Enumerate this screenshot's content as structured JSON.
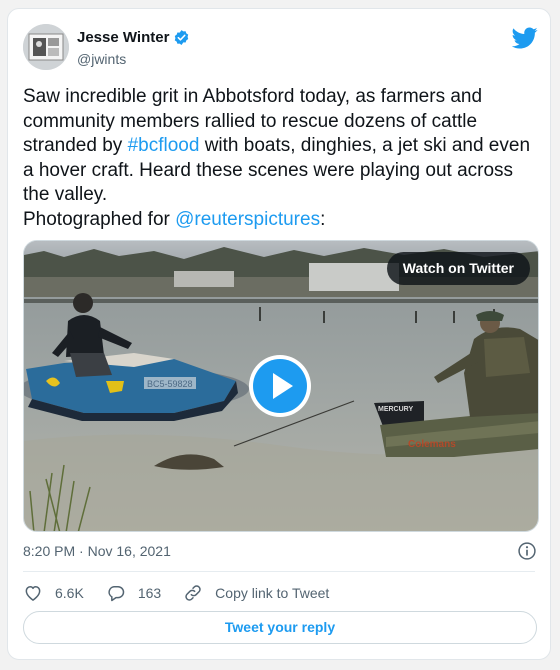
{
  "author": {
    "name": "Jesse Winter",
    "handle": "@jwints",
    "verified": true
  },
  "tweet": {
    "text_parts": [
      "Saw incredible grit in Abbotsford today, as farmers and community members rallied to rescue dozens of cattle stranded by ",
      "#bcflood",
      " with boats, dinghies, a jet ski and even a hover craft. Heard these scenes were playing out across the valley.",
      "Photographed for ",
      "@reuterspictures",
      ":"
    ]
  },
  "media": {
    "watch_label": "Watch on Twitter",
    "jetski_text": "BC5-59828",
    "boat_text": "Colemans",
    "motor_text": "MERCURY"
  },
  "meta": {
    "timestamp": "8:20 PM · Nov 16, 2021"
  },
  "actions": {
    "likes": "6.6K",
    "replies": "163",
    "copy_link": "Copy link to Tweet"
  },
  "reply_button": "Tweet your reply",
  "colors": {
    "accent": "#1d9bf0",
    "text": "#0f1419",
    "muted": "#536471"
  },
  "icons": [
    "verified-badge-icon",
    "twitter-logo-icon",
    "play-icon",
    "info-icon",
    "heart-icon",
    "reply-bubble-icon",
    "link-icon"
  ]
}
